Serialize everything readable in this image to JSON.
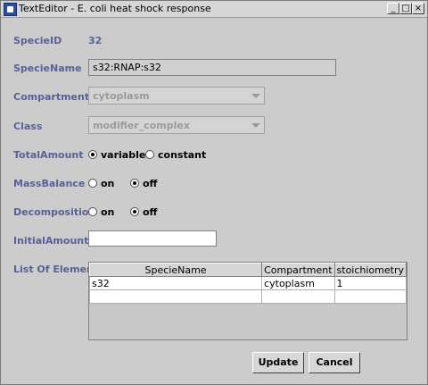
{
  "window": {
    "title": "TextEditor - E. coli heat shock response",
    "controls": {
      "minimize": "_",
      "maximize": "□",
      "close": "×"
    }
  },
  "form": {
    "specie_id": {
      "label": "SpecieID",
      "value": "32"
    },
    "specie_name": {
      "label": "SpecieName",
      "value": "s32:RNAP:s32"
    },
    "compartment": {
      "label": "Compartment",
      "value": "cytoplasm"
    },
    "class": {
      "label": "Class",
      "value": "modifier_complex"
    },
    "total_amount": {
      "label": "TotalAmount",
      "options": [
        "variable",
        "constant"
      ],
      "selected": "variable"
    },
    "mass_balance": {
      "label": "MassBalance",
      "options": [
        "on",
        "off"
      ],
      "selected": "off"
    },
    "decomposition": {
      "label": "Decomposition",
      "options": [
        "on",
        "off"
      ],
      "selected": "off"
    },
    "initial_amount": {
      "label": "InitialAmount",
      "value": ""
    },
    "list_of_elements": {
      "label": "List Of Elements",
      "columns": [
        "SpecieName",
        "Compartment",
        "stoichiometry"
      ],
      "rows": [
        [
          "s32",
          "cytoplasm",
          "1"
        ],
        [
          "",
          "",
          ""
        ]
      ]
    }
  },
  "buttons": {
    "update": "Update",
    "cancel": "Cancel"
  }
}
